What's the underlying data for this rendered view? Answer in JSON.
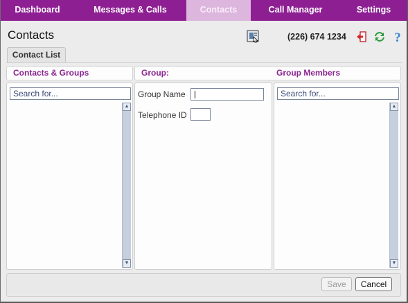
{
  "nav": {
    "tabs": [
      {
        "label": "Dashboard",
        "active": false
      },
      {
        "label": "Messages & Calls",
        "active": false
      },
      {
        "label": "Contacts",
        "active": true
      },
      {
        "label": "Call Manager",
        "active": false
      },
      {
        "label": "Settings",
        "active": false
      }
    ]
  },
  "header": {
    "title": "Contacts",
    "phone": "(226) 674 1234",
    "icons": [
      "contact-card-icon",
      "logout-icon",
      "refresh-icon",
      "help-icon"
    ]
  },
  "subtab": {
    "label": "Contact List"
  },
  "columns": {
    "left": {
      "title": "Contacts & Groups",
      "search_value": "Search for..."
    },
    "middle": {
      "title": "Group:",
      "group_name_label": "Group Name",
      "group_name_value": "",
      "telephone_id_label": "Telephone ID",
      "telephone_id_value": ""
    },
    "right": {
      "title": "Group Members",
      "search_value": "Search for..."
    }
  },
  "footer": {
    "save_label": "Save",
    "save_enabled": false,
    "cancel_label": "Cancel"
  },
  "colors": {
    "nav_bg": "#8e1f93",
    "nav_active": "#dcb6dc",
    "heading": "#8a2590"
  }
}
